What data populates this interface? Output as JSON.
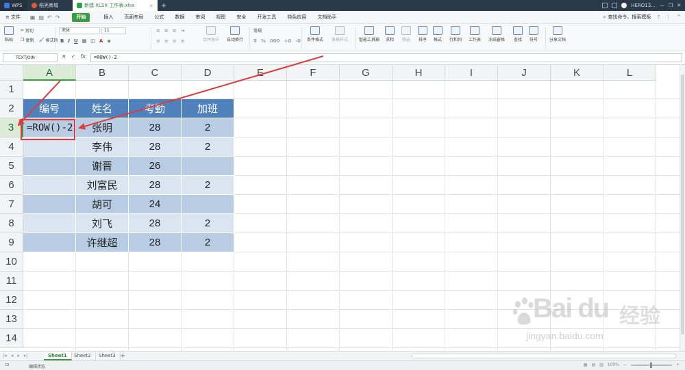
{
  "titlebar": {
    "app_tab": "WPS",
    "store_tab": "稻壳商城",
    "file_tab": "新建 XLSX 工作表.xlsx",
    "close_glyph": "×",
    "new_tab_glyph": "+",
    "user": "HERO13...",
    "win_min": "—",
    "win_restore": "❐",
    "win_close": "✕"
  },
  "menubar": {
    "file_label": "文件",
    "tabs": [
      "开始",
      "插入",
      "页面布局",
      "公式",
      "数据",
      "审阅",
      "视图",
      "安全",
      "开发工具",
      "特色应用",
      "文档助手"
    ],
    "active_tab": "开始",
    "search_label": "查找命令、搜索模板"
  },
  "ribbon": {
    "clipboard": {
      "paste": "粘贴",
      "cut": "剪切",
      "copy": "复制",
      "format_painter": "格式刷"
    },
    "font_name": "宋体",
    "font_size": "11",
    "merge_center": "合并居中",
    "wrap_text": "自动换行",
    "number_format": "常规",
    "conditional_format": "条件格式",
    "table_style": "表格样式",
    "smart_toolbox": "智能工具箱",
    "sum": "求和",
    "filter": "筛选",
    "sort": "排序",
    "format": "格式",
    "row_col": "行和列",
    "worksheet": "工作表",
    "freeze": "冻结窗格",
    "find": "查找",
    "symbol": "符号",
    "share_doc": "分享文档"
  },
  "formulabar": {
    "name_box": "TEXTJOIN",
    "cancel_glyph": "✕",
    "confirm_glyph": "✓",
    "fx_label": "fx",
    "formula": "=ROW()-2"
  },
  "grid": {
    "columns": [
      "A",
      "B",
      "C",
      "D",
      "E",
      "F",
      "G",
      "H",
      "I",
      "J",
      "K",
      "L"
    ],
    "rows": [
      "1",
      "2",
      "3",
      "4",
      "5",
      "6",
      "7",
      "8",
      "9",
      "10",
      "11",
      "12",
      "13",
      "14"
    ],
    "selected_column": "A",
    "selected_row": "3",
    "active_cell": "A3",
    "active_cell_value": "=ROW()-2",
    "table": {
      "header": [
        "编号",
        "姓名",
        "考勤",
        "加班"
      ],
      "rows": [
        [
          "",
          "张明",
          "28",
          "2"
        ],
        [
          "",
          "李伟",
          "28",
          "2"
        ],
        [
          "",
          "谢晋",
          "26",
          ""
        ],
        [
          "",
          "刘富民",
          "28",
          "2"
        ],
        [
          "",
          "胡可",
          "24",
          ""
        ],
        [
          "",
          "刘飞",
          "28",
          "2"
        ],
        [
          "",
          "许继超",
          "28",
          "2"
        ]
      ]
    }
  },
  "sheets": {
    "tabs": [
      "Sheet1",
      "Sheet2",
      "Sheet3"
    ],
    "active": "Sheet1",
    "add_glyph": "+"
  },
  "status": {
    "mode": "编辑状态",
    "zoom": "100%"
  },
  "watermark": {
    "brand": "Bai du",
    "cn": "经验",
    "url": "jingyan.baidu.com"
  },
  "colors": {
    "header_fill": "#4f81bd",
    "band_dark": "#b8cce4",
    "band_light": "#dbe5f1",
    "active_tab": "#3a9b43",
    "annotation_red": "#e03a3a"
  }
}
